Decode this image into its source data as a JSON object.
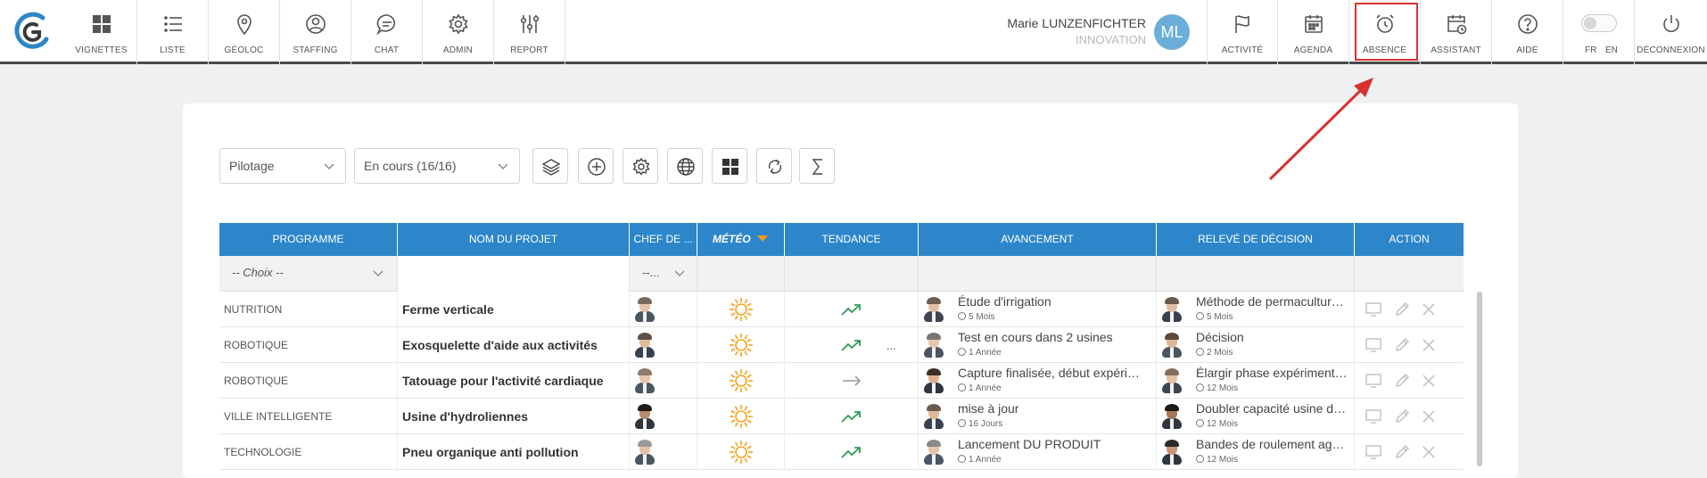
{
  "nav_left": [
    {
      "label": "VIGNETTES",
      "icon": "grid-icon"
    },
    {
      "label": "LISTE",
      "icon": "list-icon"
    },
    {
      "label": "GÉOLOC",
      "icon": "map-pin-icon"
    },
    {
      "label": "STAFFING",
      "icon": "user-circle-icon"
    },
    {
      "label": "CHAT",
      "icon": "chat-bubble-icon"
    },
    {
      "label": "ADMIN",
      "icon": "gear-icon"
    },
    {
      "label": "REPORT",
      "icon": "sliders-icon"
    }
  ],
  "user": {
    "name": "Marie LUNZENFICHTER",
    "role": "INNOVATION",
    "initials": "ML",
    "avatar_color": "#6aaed9"
  },
  "nav_right": [
    {
      "label": "ACTIVITÉ",
      "icon": "flag-icon"
    },
    {
      "label": "AGENDA",
      "icon": "calendar-icon"
    },
    {
      "label": "ABSENCE",
      "icon": "alarm-clock-icon"
    },
    {
      "label": "ASSISTANT",
      "icon": "calendar-clock-icon"
    },
    {
      "label": "AIDE",
      "icon": "help-circle-icon"
    },
    {
      "label": "",
      "icon": "toggle-icon"
    },
    {
      "label": "DÉCONNEXION",
      "icon": "power-icon"
    }
  ],
  "language": {
    "fr": "FR",
    "en": "EN"
  },
  "toolbar": {
    "view_select": "Pilotage",
    "status_select": "En cours (16/16)",
    "buttons": [
      "layers-icon",
      "add-circle-icon",
      "settings-icon",
      "globe-icon",
      "tiles-icon",
      "refresh-icon",
      "sigma-icon"
    ]
  },
  "table": {
    "columns": [
      "PROGRAMME",
      "NOM DU PROJET",
      "CHEF DE ...",
      "MÉTÉO",
      "TENDANCE",
      "AVANCEMENT",
      "RELEVÉ DE DÉCISION",
      "ACTION"
    ],
    "filters": {
      "programme": "-- Choix --",
      "chef": "--..."
    },
    "rows": [
      {
        "programme": "NUTRITION",
        "projet": "Ferme verticale",
        "chef_extra": "",
        "tendance": "up",
        "avancement": "Étude d'irrigation",
        "avancement_time": "5 Mois",
        "releve": "Méthode de permaculture…",
        "releve_time": "5 Mois"
      },
      {
        "programme": "ROBOTIQUE",
        "projet": "Exosquelette d'aide aux activités",
        "chef_extra": "...",
        "tendance": "up",
        "avancement": "Test en cours dans 2 usines",
        "avancement_time": "1 Année",
        "releve": "Décision",
        "releve_time": "2 Mois"
      },
      {
        "programme": "ROBOTIQUE",
        "projet": "Tatouage pour l'activité cardiaque",
        "chef_extra": "",
        "tendance": "flat",
        "avancement": "Capture finalisée, début expéri…",
        "avancement_time": "1 Année",
        "releve": "Élargir phase expériment…",
        "releve_time": "12 Mois"
      },
      {
        "programme": "VILLE INTELLIGENTE",
        "projet": "Usine d'hydroliennes",
        "chef_extra": "",
        "tendance": "up",
        "avancement": "mise à jour",
        "avancement_time": "16 Jours",
        "releve": "Doubler capacité usine d…",
        "releve_time": "12 Mois"
      },
      {
        "programme": "TECHNOLOGIE",
        "projet": "Pneu organique anti pollution",
        "chef_extra": "",
        "tendance": "up",
        "avancement": "Lancement DU PRODUIT",
        "avancement_time": "1 Année",
        "releve": "Bandes de roulement ag…",
        "releve_time": "12 Mois"
      }
    ]
  },
  "colors": {
    "header_blue": "#2d86c9",
    "highlight_red": "#d6322f",
    "sun_orange": "#f4a21c",
    "trend_green": "#2e9b57",
    "meteo_arrow": "#f39c12"
  }
}
